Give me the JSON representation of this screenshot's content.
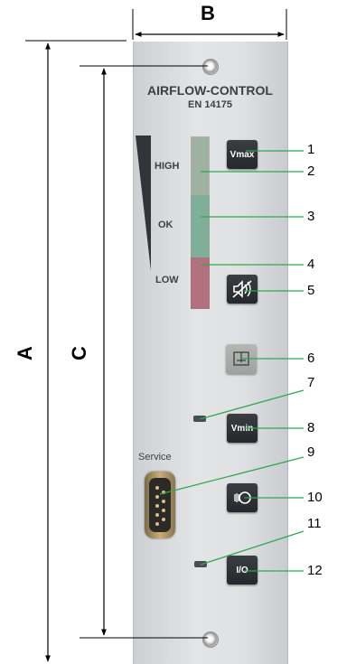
{
  "dimensions": {
    "a": "A",
    "b": "B",
    "c": "C"
  },
  "panel": {
    "title": "AIRFLOW-CONTROL",
    "subtitle": "EN 14175",
    "levels": {
      "high": "HIGH",
      "ok": "OK",
      "low": "LOW"
    },
    "buttons": {
      "vmax": "Vmax",
      "vmin": "Vmin",
      "io": "I/O"
    },
    "service": "Service"
  },
  "callouts": [
    "1",
    "2",
    "3",
    "4",
    "5",
    "6",
    "7",
    "8",
    "9",
    "10",
    "11",
    "12"
  ],
  "colors": {
    "leader": "#2fa84f",
    "bar_high": "#9fb1a1",
    "bar_ok": "#7fae9a",
    "bar_low": "#b3707e"
  }
}
